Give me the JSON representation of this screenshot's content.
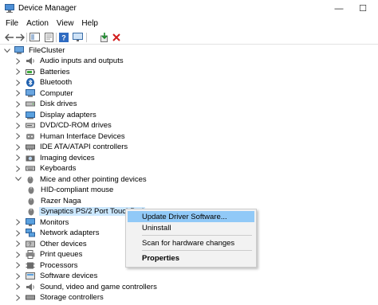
{
  "window": {
    "title": "Device Manager",
    "icon": "device-manager-icon",
    "minimize_glyph": "—",
    "maximize_glyph": "☐"
  },
  "menu": [
    "File",
    "Action",
    "View",
    "Help"
  ],
  "toolbar": {
    "icons": [
      "back-arrow-icon",
      "forward-arrow-icon",
      "show-hide-icon",
      "properties-icon",
      "help-icon",
      "monitor-icon",
      "update-driver-icon",
      "uninstall-icon"
    ],
    "uninstall_color": "#d21c1c",
    "update_color": "#1a8a2a"
  },
  "tree": {
    "root": "FileCluster",
    "items": [
      {
        "label": "Audio inputs and outputs",
        "icon": "speaker-icon",
        "expanded": false
      },
      {
        "label": "Batteries",
        "icon": "battery-icon",
        "expanded": false
      },
      {
        "label": "Bluetooth",
        "icon": "bluetooth-icon",
        "expanded": false
      },
      {
        "label": "Computer",
        "icon": "computer-icon",
        "expanded": false
      },
      {
        "label": "Disk drives",
        "icon": "disk-drive-icon",
        "expanded": false
      },
      {
        "label": "Display adapters",
        "icon": "display-adapter-icon",
        "expanded": false
      },
      {
        "label": "DVD/CD-ROM drives",
        "icon": "dvd-icon",
        "expanded": false
      },
      {
        "label": "Human Interface Devices",
        "icon": "hid-icon",
        "expanded": false
      },
      {
        "label": "IDE ATA/ATAPI controllers",
        "icon": "ide-controller-icon",
        "expanded": false
      },
      {
        "label": "Imaging devices",
        "icon": "camera-icon",
        "expanded": false
      },
      {
        "label": "Keyboards",
        "icon": "keyboard-icon",
        "expanded": false
      },
      {
        "label": "Mice and other pointing devices",
        "icon": "mouse-icon",
        "expanded": true,
        "children": [
          {
            "label": "HID-compliant mouse",
            "icon": "mouse-icon"
          },
          {
            "label": "Razer Naga",
            "icon": "mouse-icon"
          },
          {
            "label": "Synaptics PS/2 Port TouchPad",
            "icon": "mouse-icon",
            "selected": true
          }
        ]
      },
      {
        "label": "Monitors",
        "icon": "monitor-icon",
        "expanded": false
      },
      {
        "label": "Network adapters",
        "icon": "network-adapter-icon",
        "expanded": false
      },
      {
        "label": "Other devices",
        "icon": "other-devices-icon",
        "expanded": false
      },
      {
        "label": "Print queues",
        "icon": "printer-icon",
        "expanded": false
      },
      {
        "label": "Processors",
        "icon": "processor-icon",
        "expanded": false
      },
      {
        "label": "Software devices",
        "icon": "software-device-icon",
        "expanded": false
      },
      {
        "label": "Sound, video and game controllers",
        "icon": "sound-controller-icon",
        "expanded": false
      },
      {
        "label": "Storage controllers",
        "icon": "storage-controller-icon",
        "expanded": false
      }
    ]
  },
  "context_menu": {
    "update": "Update Driver Software...",
    "uninstall": "Uninstall",
    "scan": "Scan for hardware changes",
    "properties": "Properties",
    "highlight_color": "#91c9f7"
  }
}
